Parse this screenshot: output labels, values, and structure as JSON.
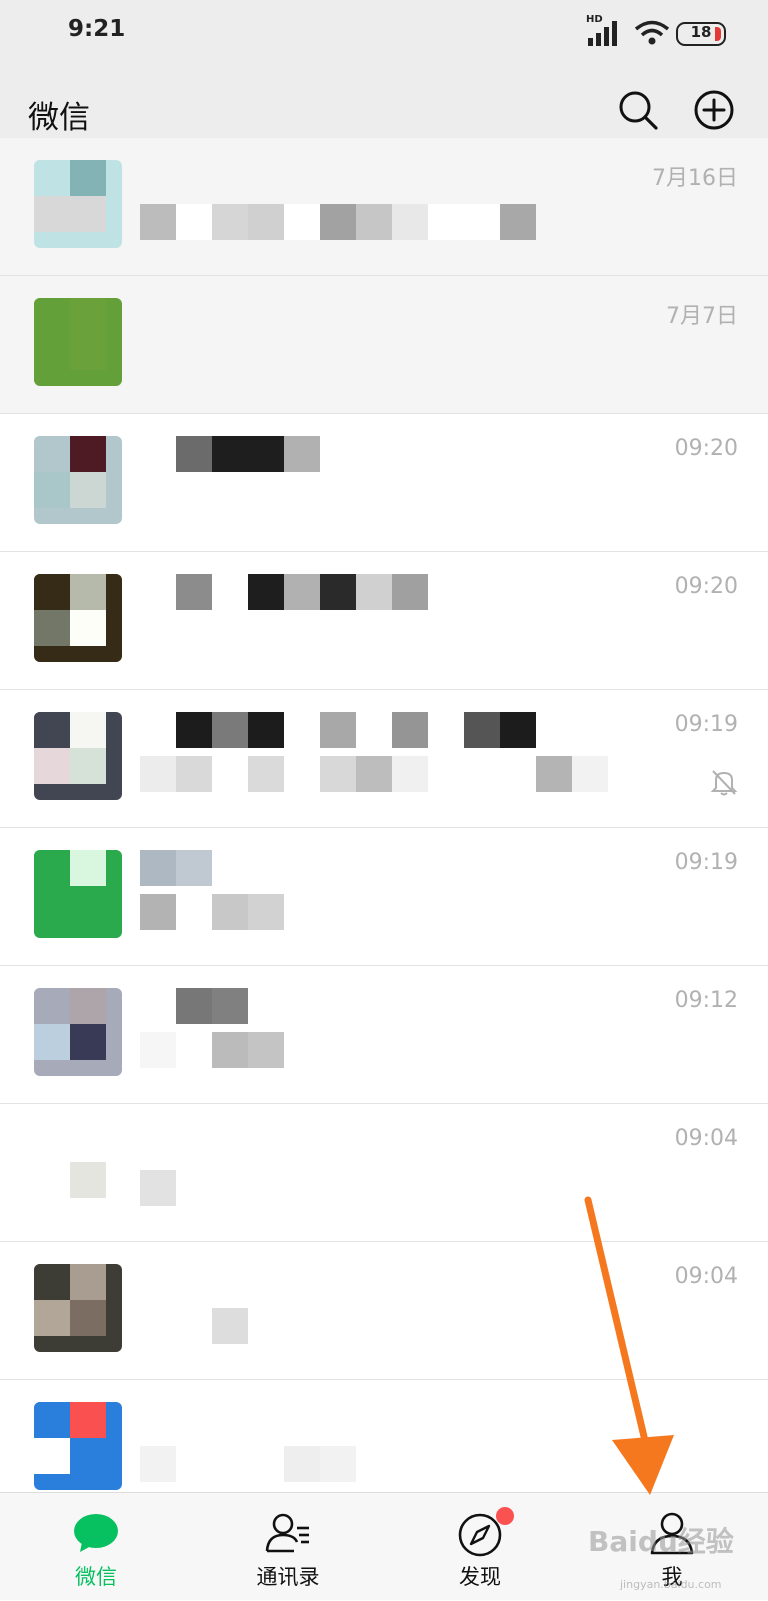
{
  "status_bar": {
    "time": "9:21",
    "network": "HD",
    "battery": "18"
  },
  "header": {
    "title": "微信"
  },
  "chats": [
    {
      "time": "7月16日",
      "pinned": true,
      "muted": false,
      "avatar": [
        "#bfe3e4",
        "#83b3b5",
        "#d8d8d8",
        "#d8d8d8"
      ],
      "name": [],
      "msg": [
        "#bcbcbc",
        "#fff",
        "#d6d6d6",
        "#d0d0d0",
        "#fff",
        "#a2a2a2",
        "#c6c6c6",
        "#e8e8e8",
        "#fff",
        "#fff",
        "#a8a8a8"
      ]
    },
    {
      "time": "7月7日",
      "pinned": true,
      "muted": false,
      "avatar": [
        "#64a03a",
        "#6aa13a",
        "#64a03a",
        "#6aa13a"
      ],
      "name": [],
      "msg": []
    },
    {
      "time": "09:20",
      "pinned": false,
      "muted": false,
      "avatar": [
        "#b2c7cc",
        "#4e1a24",
        "#a9c6c8",
        "#ccd6d2"
      ],
      "name": [
        "#fff",
        "#6b6b6b",
        "#1e1e1e",
        "#1e1e1e",
        "#b1b1b1"
      ],
      "msg": []
    },
    {
      "time": "09:20",
      "pinned": false,
      "muted": false,
      "avatar": [
        "#362b16",
        "#b5baaa",
        "#737767",
        "#fdfef7"
      ],
      "name": [
        "#fff",
        "#8c8c8c",
        "#fff",
        "#1e1e1e",
        "#b1b1b1",
        "#2a2a2a",
        "#d0d0d0",
        "#a0a0a0"
      ],
      "msg": []
    },
    {
      "time": "09:19",
      "pinned": false,
      "muted": true,
      "avatar": [
        "#424552",
        "#f6f7f2",
        "#e6d8da",
        "#d6e1d8"
      ],
      "name": [
        "#fff",
        "#1c1c1c",
        "#7a7a7a",
        "#1c1c1c",
        "#fff",
        "#a8a8a8",
        "#fff",
        "#959595",
        "#fff",
        "#555",
        "#1c1c1c"
      ],
      "msg": [
        "#ececec",
        "#d9d9d9",
        "#fff",
        "#dadada",
        "#fff",
        "#d8d8d8",
        "#bdbdbd",
        "#f0f0f0",
        "#fff",
        "#fff",
        "#fff",
        "#b4b4b4",
        "#f2f2f2"
      ]
    },
    {
      "time": "09:19",
      "pinned": false,
      "muted": false,
      "avatar": [
        "#2aaa4c",
        "#d9f7de",
        "#2aaa4c",
        "#2aaa4c"
      ],
      "name": [
        "#aeb8c2",
        "#c0c9d2"
      ],
      "msg": [
        "#b3b3b3",
        "#fff",
        "#c8c8c8",
        "#d2d2d2"
      ]
    },
    {
      "time": "09:12",
      "pinned": false,
      "muted": false,
      "avatar": [
        "#a7aab9",
        "#aea5ab",
        "#bccfdf",
        "#393a56"
      ],
      "name": [
        "#fff",
        "#777",
        "#808080"
      ],
      "msg": [
        "#f6f6f6",
        "#fff",
        "#bbbbbb",
        "#c4c4c4"
      ]
    },
    {
      "time": "09:04",
      "pinned": false,
      "muted": false,
      "avatar": [
        "#fff",
        "#fff",
        "#fff",
        "#e5e5df"
      ],
      "name": [],
      "msg": [
        "#e2e2e2"
      ]
    },
    {
      "time": "09:04",
      "pinned": false,
      "muted": false,
      "avatar": [
        "#3d3d36",
        "#a99d92",
        "#b2a698",
        "#7c6d63"
      ],
      "name": [],
      "msg": [
        "#fff",
        "#fff",
        "#dddddd"
      ]
    },
    {
      "time": "",
      "pinned": false,
      "muted": false,
      "avatar": [
        "#2a7fdc",
        "#fa5050",
        "#fff",
        "#2a7fdc"
      ],
      "name": [],
      "msg": [
        "#f2f2f2",
        "#fff",
        "#fff",
        "#fff",
        "#eeeeee",
        "#f2f2f2"
      ]
    }
  ],
  "tabs": [
    {
      "label": "微信",
      "icon": "chat-bubble-icon",
      "active": true
    },
    {
      "label": "通讯录",
      "icon": "contacts-icon",
      "active": false
    },
    {
      "label": "发现",
      "icon": "compass-icon",
      "active": false,
      "badge_dot": true
    },
    {
      "label": "我",
      "icon": "person-icon",
      "active": false
    }
  ],
  "colors": {
    "accent": "#07c160",
    "header_bg": "#ededed",
    "arrow": "#f5781e",
    "badge": "#fa5151"
  },
  "watermark": {
    "main": "Baidu经验",
    "sub": "jingyan.baidu.com"
  }
}
